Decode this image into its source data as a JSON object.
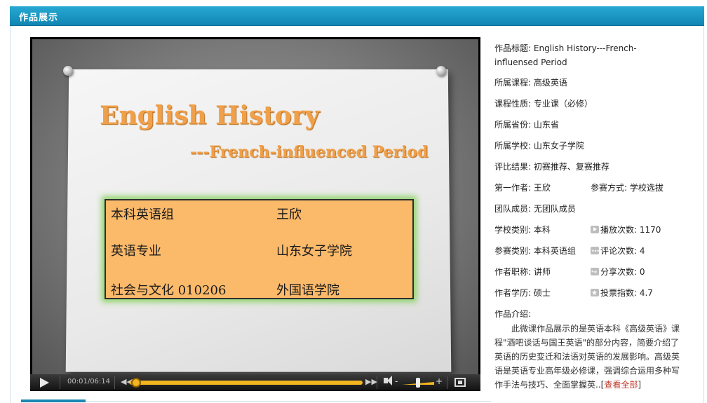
{
  "header": {
    "title": "作品展示"
  },
  "video": {
    "slide_title": "English History",
    "slide_subtitle": "---French-influenced Period",
    "box": {
      "r1c1": "本科英语组",
      "r1c2": "王欣",
      "r2c1": "英语专业",
      "r2c2": "山东女子学院",
      "r3c1": "社会与文化 010206",
      "r3c2": "外国语学院"
    }
  },
  "player": {
    "time": "00:01/06:14",
    "progress": 0.02,
    "volume": 0.5,
    "icons": [
      "play-icon",
      "rewind-icon",
      "fast-forward-icon",
      "volume-icon",
      "fullscreen-icon"
    ]
  },
  "details": {
    "title_label": "作品标题:",
    "title_value": "English History---French-influensed Period",
    "course": "所属课程: 高级英语",
    "nature": "课程性质: 专业课（必修）",
    "province": "所属省份: 山东省",
    "school": "所属学校: 山东女子学院",
    "result": "评比结果: 初赛推荐、复赛推荐",
    "first_author": "第一作者: 王欣",
    "participation": "参赛方式: 学校选拔",
    "team": "团队成员: 无团队成员",
    "school_type": "学校类别: 本科",
    "plays": "播放次数: 1170",
    "category": "参赛类别: 本科英语组",
    "comments": "评论次数: 4",
    "author_title": "作者职称: 讲师",
    "shares": "分享次数: 0",
    "degree": "作者学历: 硕士",
    "vote_index": "投票指数: 4.7",
    "intro_label": "作品介绍:",
    "intro_text": "此微课作品展示的是英语本科《高级英语》课程\"酒吧谈话与国王英语\"的部分内容，简要介绍了英语的历史变迁和法语对英语的发展影响。高级英语是英语专业高年级必修课，强调综合运用多种写作手法与技巧、全面掌握英..",
    "more_link": "查看全部"
  }
}
